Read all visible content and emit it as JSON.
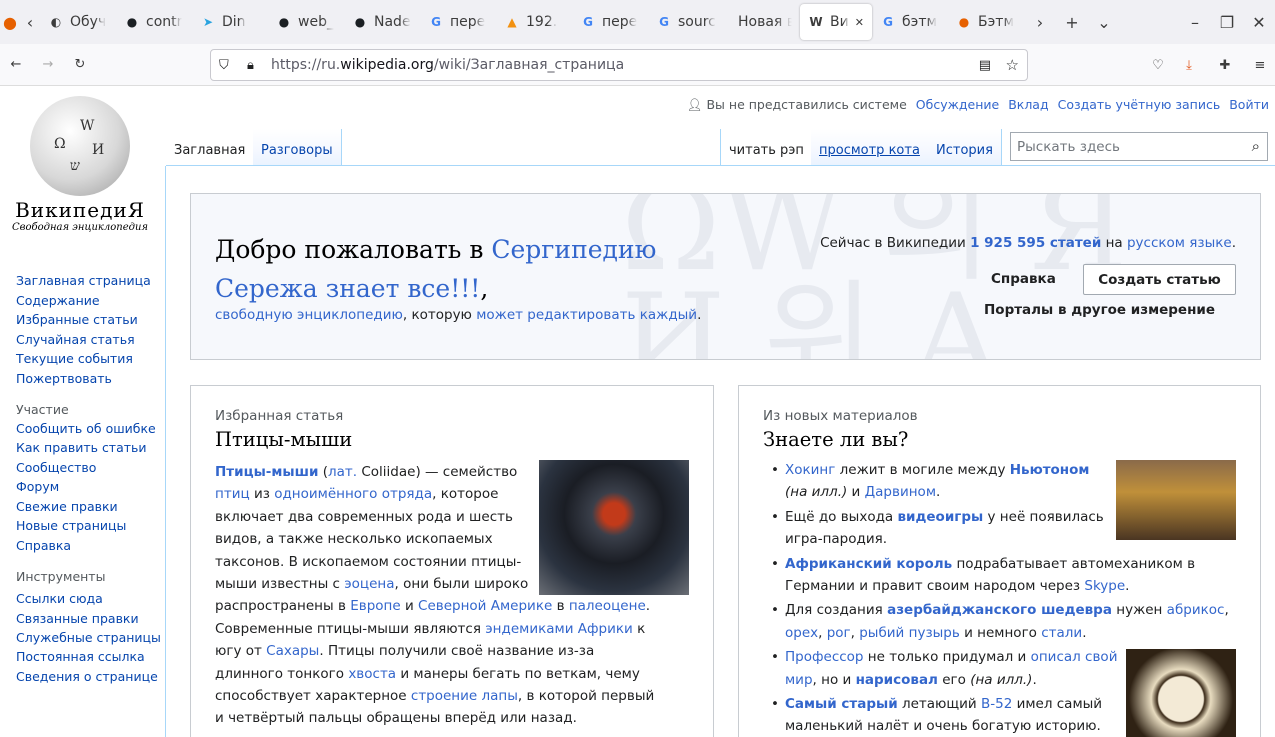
{
  "browser": {
    "tabs": [
      {
        "title": "Обуч",
        "icon": "firefox-view-icon"
      },
      {
        "title": "contr",
        "icon": "github-icon"
      },
      {
        "title": "Din",
        "icon": "telegram-icon"
      },
      {
        "title": "web_",
        "icon": "github-icon"
      },
      {
        "title": "Nade",
        "icon": "github-icon"
      },
      {
        "title": "пере",
        "icon": "google-icon"
      },
      {
        "title": "192.",
        "icon": "pma-icon"
      },
      {
        "title": "пере",
        "icon": "google-icon"
      },
      {
        "title": "sourc",
        "icon": "google-icon"
      },
      {
        "title": "Новая в",
        "icon": ""
      },
      {
        "title": "Вик",
        "icon": "wikipedia-icon"
      },
      {
        "title": "бэтм",
        "icon": "google-icon"
      },
      {
        "title": "Бэтм",
        "icon": "firefox-icon"
      }
    ],
    "url_prefix": "https://ru.",
    "url_domain": "wikipedia.org",
    "url_path": "/wiki/Заглавная_страница"
  },
  "wiki": {
    "logo": {
      "wordmark": "ВикипедиЯ",
      "tagline": "Свободная энциклопедия"
    },
    "personal": {
      "not_logged": "Вы не представились системе",
      "links": [
        "Обсуждение",
        "Вклад",
        "Создать учётную запись",
        "Войти"
      ]
    },
    "tabs_left": [
      "Заглавная",
      "Разговоры"
    ],
    "tabs_right": [
      "читать рэп",
      "просмотр кота",
      "История"
    ],
    "search_placeholder": "Рыскать здесь",
    "sidebar": {
      "main": [
        "Заглавная страница",
        "Содержание",
        "Избранные статьи",
        "Случайная статья",
        "Текущие события",
        "Пожертвовать"
      ],
      "participation_heading": "Участие",
      "participation": [
        "Сообщить об ошибке",
        "Как править статьи",
        "Сообщество",
        "Форум",
        "Свежие правки",
        "Новые страницы",
        "Справка"
      ],
      "tools_heading": "Инструменты",
      "tools": [
        "Ссылки сюда",
        "Связанные правки",
        "Служебные страницы",
        "Постоянная ссылка",
        "Сведения о странице"
      ]
    },
    "banner": {
      "welcome_prefix": "Добро пожаловать в ",
      "welcome_link": "Сергипедию Сережа знает все!!!",
      "welcome_suffix": ",",
      "sub_link1": "свободную энциклопедию",
      "sub_mid": ", которую ",
      "sub_link2": "может редактировать каждый",
      "sub_end": ".",
      "stats_prefix": "Сейчас в Википедии ",
      "stats_count": "1 925 595 статей",
      "stats_mid": " на ",
      "stats_lang": "русском языке",
      "stats_end": ".",
      "help": "Справка",
      "create": "Создать статью",
      "portals": "Порталы в другое измерение"
    },
    "featured": {
      "caption": "Избранная статья",
      "title": "Птицы-мыши"
    },
    "news": {
      "caption": "Из новых материалов",
      "title": "Знаете ли вы?"
    }
  }
}
